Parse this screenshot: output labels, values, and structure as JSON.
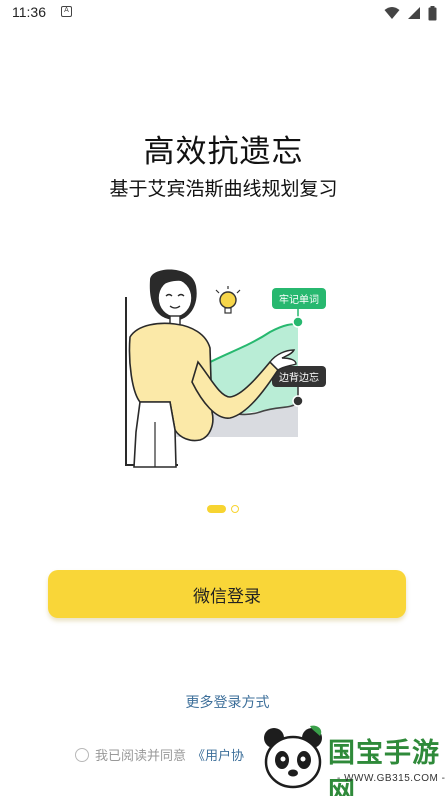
{
  "status_bar": {
    "time": "11:36",
    "notification_glyph": "A"
  },
  "onboarding": {
    "title": "高效抗遗忘",
    "subtitle": "基于艾宾浩斯曲线规划复习",
    "tag_remember": "牢记单词",
    "tag_forget": "边背边忘",
    "page_index": 1,
    "page_count": 2
  },
  "wechat_login_label": "微信登录",
  "more_login_label": "更多登录方式",
  "agreement": {
    "prefix": "我已阅读并同意",
    "link": "《用户协"
  },
  "watermark": {
    "brand": "国宝手游网",
    "url": "- WWW.GB315.COM -"
  },
  "colors": {
    "accent": "#f9d638",
    "link": "#3d6f9a",
    "tag_green": "#27b86f",
    "tag_dark": "#333333"
  }
}
